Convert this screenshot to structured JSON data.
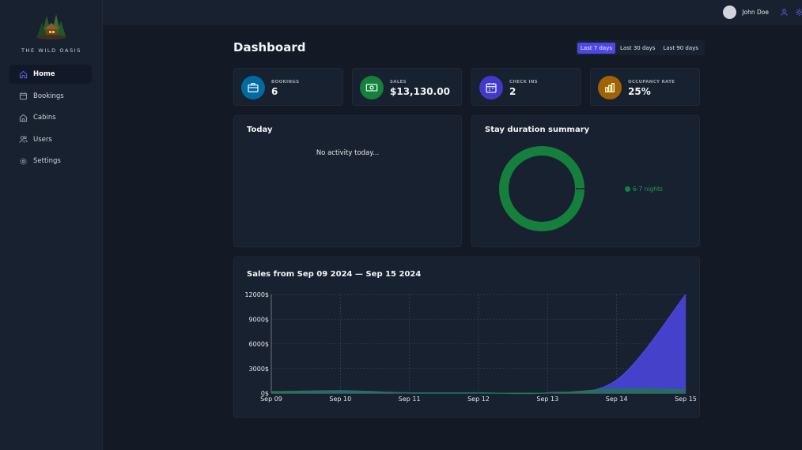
{
  "brand": {
    "name": "THE WILD OASIS"
  },
  "sidebar": {
    "items": [
      {
        "label": "Home",
        "icon": "home-icon",
        "active": true
      },
      {
        "label": "Bookings",
        "icon": "calendar-icon",
        "active": false
      },
      {
        "label": "Cabins",
        "icon": "cabin-icon",
        "active": false
      },
      {
        "label": "Users",
        "icon": "users-icon",
        "active": false
      },
      {
        "label": "Settings",
        "icon": "gear-icon",
        "active": false
      }
    ]
  },
  "header": {
    "user_name": "John Doe",
    "icons": [
      "user-icon",
      "theme-toggle-icon"
    ]
  },
  "dashboard": {
    "title": "Dashboard",
    "filters": [
      {
        "label": "Last 7 days",
        "active": true
      },
      {
        "label": "Last 30 days",
        "active": false
      },
      {
        "label": "Last 90 days",
        "active": false
      }
    ],
    "stats": [
      {
        "label": "BOOKINGS",
        "value": "6",
        "icon": "briefcase-icon",
        "color": "#0369a1"
      },
      {
        "label": "SALES",
        "value": "$13,130.00",
        "icon": "banknotes-icon",
        "color": "#15803d"
      },
      {
        "label": "CHECK INS",
        "value": "2",
        "icon": "calendar-days-icon",
        "color": "#4338ca"
      },
      {
        "label": "OCCUPANCY RATE",
        "value": "25%",
        "icon": "chart-bar-icon",
        "color": "#a16207"
      }
    ],
    "today": {
      "title": "Today",
      "empty_text": "No activity today..."
    },
    "stay_summary": {
      "title": "Stay duration summary",
      "legend": [
        "6-7 nights"
      ]
    },
    "sales_title": "Sales from Sep 09 2024 — Sep 15 2024"
  },
  "chart_data": [
    {
      "type": "pie",
      "title": "Stay duration summary",
      "categories": [
        "6-7 nights"
      ],
      "values": [
        1
      ],
      "colors": [
        "#15803d"
      ],
      "legend": "right"
    },
    {
      "type": "area",
      "title": "Sales from Sep 09 2024 — Sep 15 2024",
      "categories": [
        "Sep 09",
        "Sep 10",
        "Sep 11",
        "Sep 12",
        "Sep 13",
        "Sep 14",
        "Sep 15"
      ],
      "series": [
        {
          "values": [
            150,
            300,
            50,
            50,
            50,
            1600,
            12000
          ],
          "color": "#4f46e5"
        },
        {
          "values": [
            200,
            250,
            0,
            0,
            0,
            500,
            400
          ],
          "color": "#15803d"
        }
      ],
      "yticks": [
        "0$",
        "3000$",
        "6000$",
        "9000$",
        "12000$"
      ],
      "ylim": [
        0,
        12000
      ],
      "grid": true
    }
  ]
}
